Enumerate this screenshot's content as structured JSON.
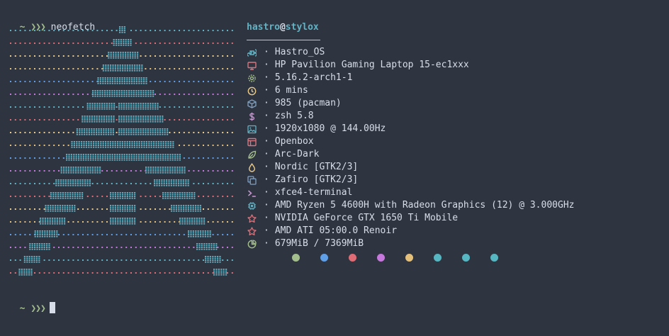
{
  "terminal": {
    "prompt_symbol": "~",
    "prompt_arrows": "❯❯❯",
    "command": "neofetch"
  },
  "neofetch": {
    "user": "hastro",
    "at": "@",
    "host": "stylox",
    "separator": "·",
    "rows": [
      {
        "icon": "command-icon",
        "color": "#5fb3c5",
        "value": "Hastro_OS"
      },
      {
        "icon": "monitor-icon",
        "color": "#d57780",
        "value": "HP Pavilion Gaming Laptop 15-ec1xxx"
      },
      {
        "icon": "gear-icon",
        "color": "#a3be8c",
        "value": "5.16.2-arch1-1"
      },
      {
        "icon": "clock-icon",
        "color": "#ebcb8b",
        "value": "6 mins"
      },
      {
        "icon": "package-icon",
        "color": "#81a1c1",
        "value": "985 (pacman)"
      },
      {
        "icon": "dollar-icon",
        "color": "#c895d1",
        "value": "zsh 5.8"
      },
      {
        "icon": "image-icon",
        "color": "#5fb3c5",
        "value": "1920x1080 @ 144.00Hz"
      },
      {
        "icon": "window-icon",
        "color": "#d57780",
        "value": "Openbox"
      },
      {
        "icon": "leaf-icon",
        "color": "#a3be8c",
        "value": "Arc-Dark"
      },
      {
        "icon": "droplet-icon",
        "color": "#ebcb8b",
        "value": "Nordic [GTK2/3]"
      },
      {
        "icon": "copy-icon",
        "color": "#81a1c1",
        "value": "Zafiro [GTK2/3]"
      },
      {
        "icon": "terminal-icon",
        "color": "#c895d1",
        "value": "xfce4-terminal"
      },
      {
        "icon": "cpu-icon",
        "color": "#5fb3c5",
        "value": "AMD Ryzen 5 4600H with Radeon Graphics (12) @ 3.000GHz"
      },
      {
        "icon": "star-icon",
        "color": "#d57780",
        "value": "NVIDIA GeForce GTX 1650 Ti Mobile"
      },
      {
        "icon": "star-icon",
        "color": "#d57780",
        "value": "AMD ATI 05:00.0 Renoir"
      },
      {
        "icon": "pie-icon",
        "color": "#a3be8c",
        "value": "679MiB / 7369MiB"
      }
    ],
    "palette": [
      "#a3be8c",
      "#5e9fe8",
      "#e06c75",
      "#c678dd",
      "#e5c07b",
      "#56b6c2",
      "#56b6c2",
      "#56b6c2"
    ]
  },
  "art": {
    "fill_color": "#5fb3c5",
    "dot_colors": [
      "#5fb3c5",
      "#e06c75",
      "#ebcb8b",
      "#e5c07b",
      "#5e9fe8",
      "#c678dd"
    ]
  },
  "prompt2": {
    "prompt_symbol": "~",
    "prompt_arrows": "❯❯❯"
  }
}
